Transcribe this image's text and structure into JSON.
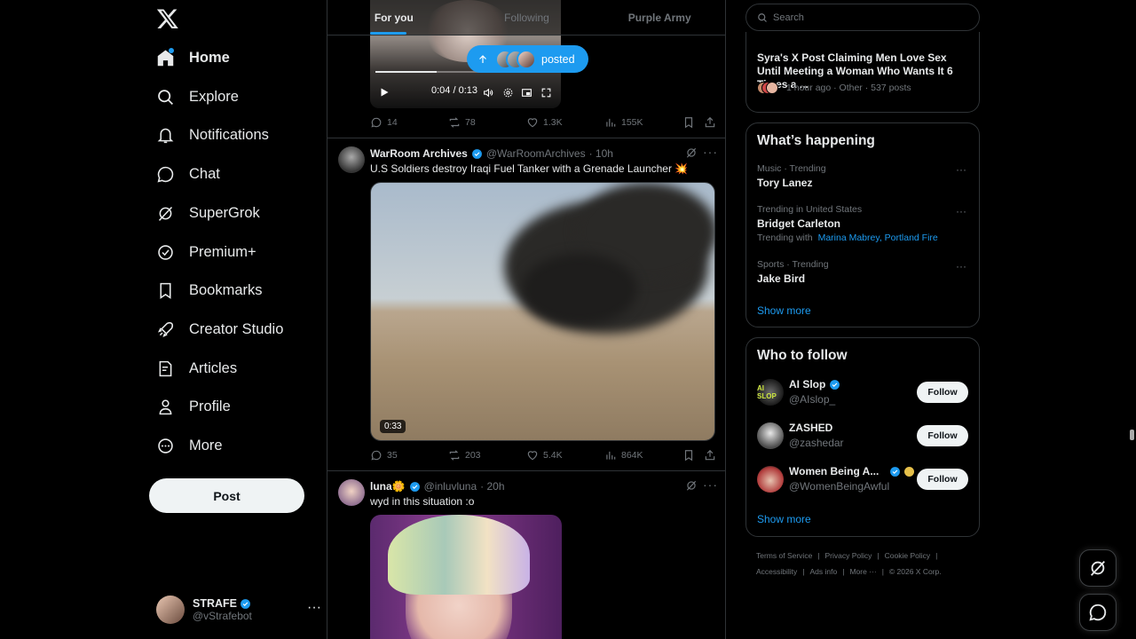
{
  "nav": {
    "items": [
      {
        "label": "Home",
        "icon": "home-icon"
      },
      {
        "label": "Explore",
        "icon": "search-icon"
      },
      {
        "label": "Notifications",
        "icon": "bell-icon"
      },
      {
        "label": "Chat",
        "icon": "chat-icon"
      },
      {
        "label": "SuperGrok",
        "icon": "grok-icon"
      },
      {
        "label": "Premium+",
        "icon": "verified-badge-icon"
      },
      {
        "label": "Bookmarks",
        "icon": "bookmark-icon"
      },
      {
        "label": "Creator Studio",
        "icon": "rocket-icon"
      },
      {
        "label": "Articles",
        "icon": "article-icon"
      },
      {
        "label": "Profile",
        "icon": "person-icon"
      },
      {
        "label": "More",
        "icon": "more-circle-icon"
      }
    ],
    "post_label": "Post",
    "account": {
      "name": "STRAFE",
      "handle": "@vStrafebot"
    }
  },
  "tabs": [
    "For you",
    "Following",
    "Purple Army"
  ],
  "posted_pill": "posted",
  "post1": {
    "video_time": "0:04 / 0:13",
    "video_progress": 0.34,
    "stats": {
      "replies": "14",
      "reposts": "78",
      "likes": "1.3K",
      "views": "155K"
    }
  },
  "post2": {
    "name": "WarRoom Archives",
    "handle": "@WarRoomArchives",
    "time": "· 10h",
    "text": "U.S Soldiers destroy Iraqi Fuel Tanker with a Grenade Launcher 💥",
    "duration": "0:33",
    "stats": {
      "replies": "35",
      "reposts": "203",
      "likes": "5.4K",
      "views": "864K"
    }
  },
  "post3": {
    "name": "luna🌼",
    "handle": "@inluvluna",
    "time": "· 20h",
    "text": "wyd in this situation :o"
  },
  "search": {
    "placeholder": "Search"
  },
  "news": {
    "title": "Syra's X Post Claiming Men Love Sex Until Meeting a Woman Who Wants It 6 Times a ...",
    "meta": "1 hour ago · Other · 537 posts"
  },
  "happening": {
    "title": "What’s happening",
    "trends": [
      {
        "context": "Music · Trending",
        "name": "Tory Lanez"
      },
      {
        "context": "Trending in United States",
        "name": "Bridget Carleton",
        "with_label": "Trending with",
        "with": "Marina Mabrey, Portland Fire"
      },
      {
        "context": "Sports · Trending",
        "name": "Jake Bird"
      }
    ],
    "show_more": "Show more"
  },
  "who_to_follow": {
    "title": "Who to follow",
    "accounts": [
      {
        "name": "AI Slop",
        "handle": "@AIslop_",
        "button": "Follow"
      },
      {
        "name": "ZASHED",
        "handle": "@zashedar",
        "button": "Follow"
      },
      {
        "name": "Women Being A...",
        "handle": "@WomenBeingAwful",
        "button": "Follow"
      }
    ],
    "show_more": "Show more"
  },
  "footer": {
    "links1": [
      "Terms of Service",
      "Privacy Policy",
      "Cookie Policy"
    ],
    "links2": [
      "Accessibility",
      "Ads info",
      "More ···",
      "© 2026 X Corp."
    ]
  },
  "colors": {
    "accent": "#1d9bf0",
    "background": "#000000",
    "border": "#2f3336",
    "muted": "#71767b"
  }
}
